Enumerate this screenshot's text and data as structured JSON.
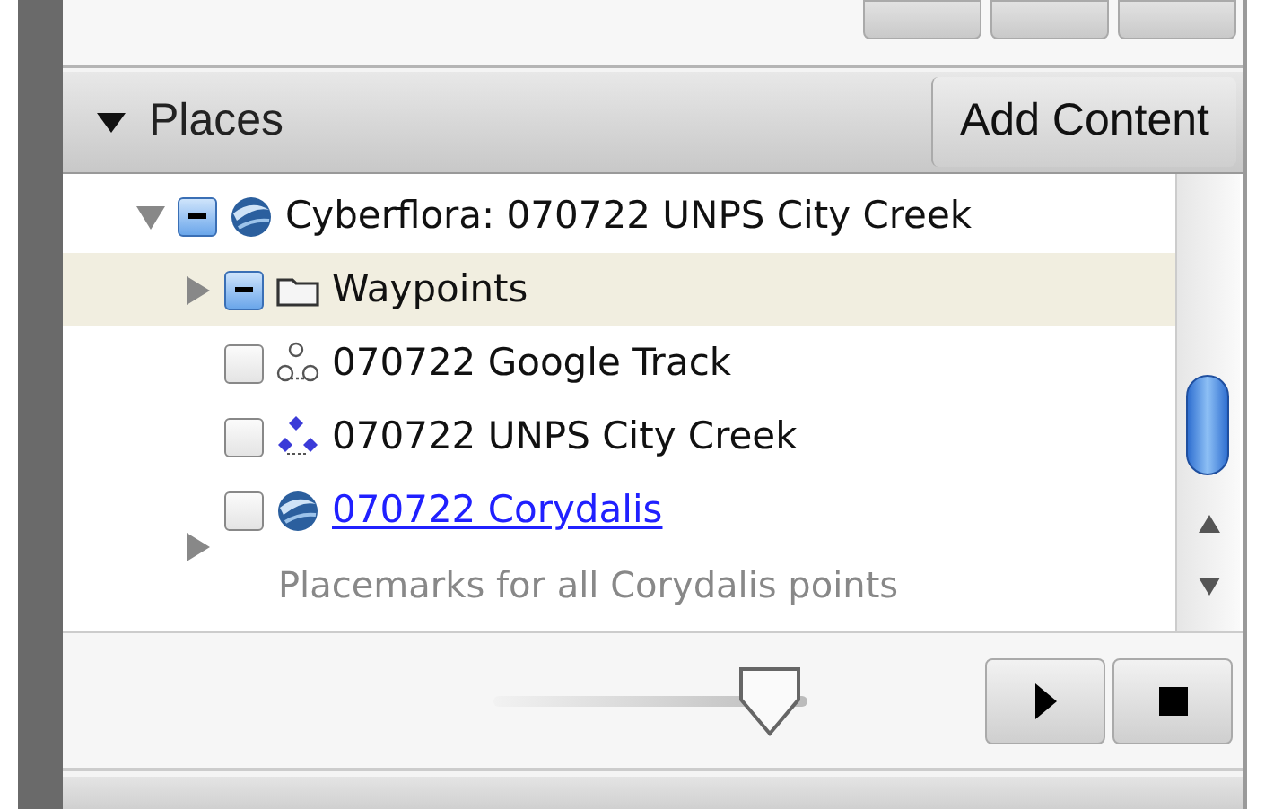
{
  "places_panel": {
    "title": "Places",
    "expanded": true,
    "add_button": "Add Content"
  },
  "tree": [
    {
      "label": "Cyberflora: 070722 UNPS City Creek",
      "kind": "globe",
      "checked": true,
      "mixed": true,
      "expanded": true,
      "selected": false,
      "children": [
        {
          "label": "Waypoints",
          "kind": "folder",
          "checked": true,
          "mixed": true,
          "expanded": false,
          "selected": true
        },
        {
          "label": "070722 Google Track",
          "kind": "track",
          "checked": false,
          "selected": false
        },
        {
          "label": "070722 UNPS City Creek",
          "kind": "track_blue",
          "checked": false,
          "selected": false
        },
        {
          "label": "070722 Corydalis",
          "kind": "globe",
          "checked": false,
          "expanded": false,
          "selected": false,
          "link": true,
          "description": "Placemarks for all Corydalis points"
        }
      ]
    }
  ],
  "slider": {
    "level": 0.88
  }
}
